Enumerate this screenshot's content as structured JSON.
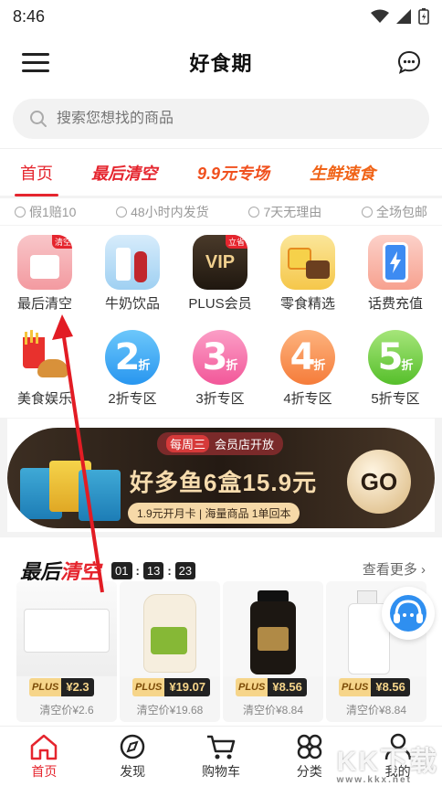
{
  "status": {
    "time": "8:46"
  },
  "app": {
    "title": "好食期"
  },
  "search": {
    "placeholder": "搜索您想找的商品"
  },
  "tabs": [
    {
      "label": "首页"
    },
    {
      "label": "最后清空"
    },
    {
      "label": "9.9元专场"
    },
    {
      "label": "生鲜速食"
    }
  ],
  "promises": [
    "假1赔10",
    "48小时内发货",
    "7天无理由",
    "全场包邮"
  ],
  "categories": [
    {
      "label": "最后清空",
      "tag": "清空"
    },
    {
      "label": "牛奶饮品"
    },
    {
      "label": "PLUS会员",
      "tag": "立省",
      "text": "VIP"
    },
    {
      "label": "零食精选"
    },
    {
      "label": "话费充值"
    },
    {
      "label": "美食娱乐"
    },
    {
      "label": "2折专区",
      "digit": "2",
      "unit": "折"
    },
    {
      "label": "3折专区",
      "digit": "3",
      "unit": "折"
    },
    {
      "label": "4折专区",
      "digit": "4",
      "unit": "折"
    },
    {
      "label": "5折专区",
      "digit": "5",
      "unit": "折"
    }
  ],
  "banner": {
    "badge_left": "每周三",
    "badge_right": "会员店开放",
    "headline": "好多鱼6盒15.9元",
    "sub": "1.9元开月卡 | 海量商品 1单回本",
    "go": "GO"
  },
  "flash_sale": {
    "title_a": "最后",
    "title_b": "清空",
    "timer": [
      "01",
      "13",
      "23"
    ],
    "more": "查看更多",
    "products": [
      {
        "plus": "PLUS",
        "price": "¥2.3",
        "orig": "清空价¥2.6"
      },
      {
        "plus": "PLUS",
        "price": "¥19.07",
        "orig": "清空价¥19.68"
      },
      {
        "plus": "PLUS",
        "price": "¥8.56",
        "orig": "清空价¥8.84"
      },
      {
        "plus": "PLUS",
        "price": "¥8.56",
        "orig": "清空价¥8.84"
      }
    ]
  },
  "nav": [
    {
      "label": "首页"
    },
    {
      "label": "发现"
    },
    {
      "label": "购物车"
    },
    {
      "label": "分类"
    },
    {
      "label": "我的"
    }
  ],
  "watermark": {
    "main": "KK下载",
    "sub": "www.kkx.net"
  },
  "colors": {
    "accent": "#e5252e",
    "gold": "#f6d58a"
  }
}
